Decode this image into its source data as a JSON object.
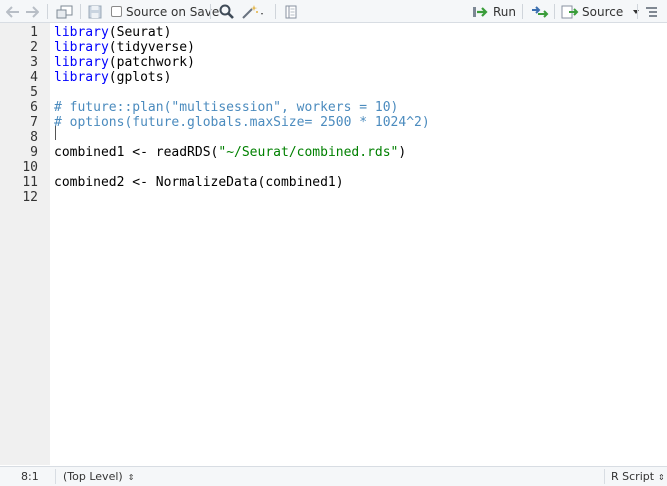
{
  "toolbar": {
    "source_on_save_label": "Source on Save",
    "run_label": "Run",
    "source_label": "Source"
  },
  "editor": {
    "line_numbers": [
      "1",
      "2",
      "3",
      "4",
      "5",
      "6",
      "7",
      "8",
      "9",
      "10",
      "11",
      "12"
    ],
    "lines": [
      [
        {
          "t": "library",
          "c": "kw"
        },
        {
          "t": "(Seurat)",
          "c": ""
        }
      ],
      [
        {
          "t": "library",
          "c": "kw"
        },
        {
          "t": "(tidyverse)",
          "c": ""
        }
      ],
      [
        {
          "t": "library",
          "c": "kw"
        },
        {
          "t": "(patchwork)",
          "c": ""
        }
      ],
      [
        {
          "t": "library",
          "c": "kw"
        },
        {
          "t": "(gplots)",
          "c": ""
        }
      ],
      [],
      [
        {
          "t": "# future::plan(\"multisession\", workers = 10)",
          "c": "cm"
        }
      ],
      [
        {
          "t": "# options(future.globals.maxSize= 2500 * 1024^2)",
          "c": "cm"
        }
      ],
      [],
      [
        {
          "t": "combined1 <- readRDS(",
          "c": ""
        },
        {
          "t": "\"~/Seurat/combined.rds\"",
          "c": "str"
        },
        {
          "t": ")",
          "c": ""
        }
      ],
      [],
      [
        {
          "t": "combined2 <- NormalizeData(combined1)",
          "c": ""
        }
      ],
      []
    ]
  },
  "status": {
    "cursor_position": "8:1",
    "scope": "(Top Level)",
    "file_type": "R Script"
  },
  "colors": {
    "keyword": "#0000ff",
    "comment": "#4b8bbe",
    "string": "#008000",
    "run_arrow": "#3a9d3a"
  }
}
